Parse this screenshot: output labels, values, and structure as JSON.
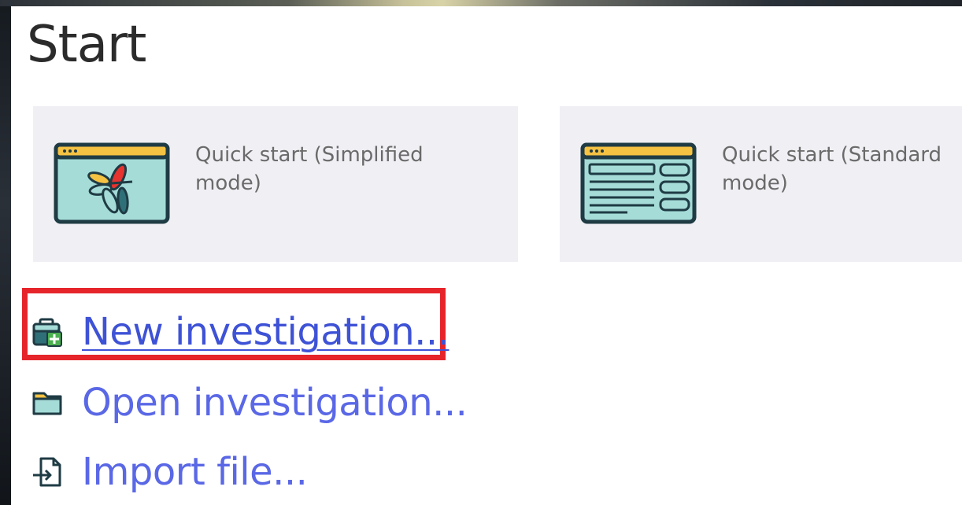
{
  "page": {
    "title": "Start"
  },
  "tiles": [
    {
      "label": "Quick start (Simplified mode)",
      "icon": "simplified-mode-icon"
    },
    {
      "label": "Quick start (Standard mode)",
      "icon": "standard-mode-icon"
    }
  ],
  "actions": {
    "new_investigation": {
      "label": "New investigation...",
      "icon": "new-investigation-icon"
    },
    "open_investigation": {
      "label": "Open investigation...",
      "icon": "folder-icon"
    },
    "import_file": {
      "label": "Import file...",
      "icon": "import-file-icon"
    }
  },
  "colors": {
    "link": "#5a68e6",
    "highlight": "#e6252b",
    "tile_bg": "#efeff4"
  }
}
